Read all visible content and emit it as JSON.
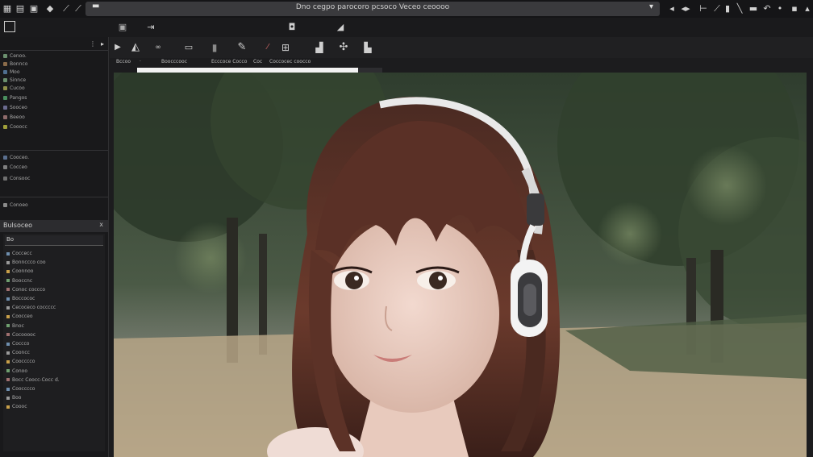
{
  "window": {
    "title": "Dno cegpo parocoro pcsoco Veceo ceoooo",
    "left_marker": "▬",
    "dropdown_marker": "▾"
  },
  "left_panel": {
    "rows_top": [
      "Cenoo.",
      "Bonnco",
      "Moo",
      "Sinnce",
      "Cucoo",
      "Pangos",
      "Sooceo",
      "Beeoo",
      "Cooocc"
    ],
    "rows_mid": [
      "Cooceo.",
      "Cocceo",
      "Consooc"
    ],
    "rows_bottom": [
      "Conoeo"
    ]
  },
  "panel2": {
    "title": "Bulsoceo",
    "close": "x",
    "selected": "Bo",
    "items": [
      "Coccecc",
      "Bonnccco coo",
      "Coonnoo",
      "Booccnc",
      "Conoc coccco",
      "Boccococ",
      "Cecoceco coccccc",
      "Coocceo",
      "Bnoc",
      "Cocooooc",
      "Coccco",
      "Cooncc",
      "Coocccco",
      "Conoo",
      "Bocc Coocc-Cocc d.",
      "Coocccco",
      "Boo",
      "Coooc"
    ]
  },
  "tabs": {
    "items": [
      "Bccoo",
      "Boocccooc",
      "Ecccoce Cocco",
      "Coc",
      "Coccocec coocco"
    ],
    "marker": "·"
  },
  "progress": {
    "value": 0.9
  },
  "colors": {
    "bg": "#1c1c1e",
    "panel": "#19191b",
    "titlefield": "#3a3a3d",
    "progress": "#f2f2f2"
  },
  "icons": {
    "topbar_left": [
      "menu-icon",
      "document-icon",
      "image-icon",
      "paint-bucket-icon",
      "wand-icon"
    ],
    "topbar_right": [
      "arrow-left-icon",
      "arrow-right-icon",
      "crop-icon",
      "bar-icon",
      "select-icon",
      "pen-icon",
      "stack-icon",
      "layers-icon",
      "undo-icon",
      "dot-icon",
      "save-icon",
      "cursor-icon"
    ],
    "toolbar": [
      "play-icon",
      "shape-icon",
      "brush-dots-icon",
      "frame-icon",
      "panel-icon",
      "pen-tool-icon",
      "line-icon",
      "grid-icon",
      "file-icon",
      "tree-icon",
      "flag-icon"
    ]
  }
}
